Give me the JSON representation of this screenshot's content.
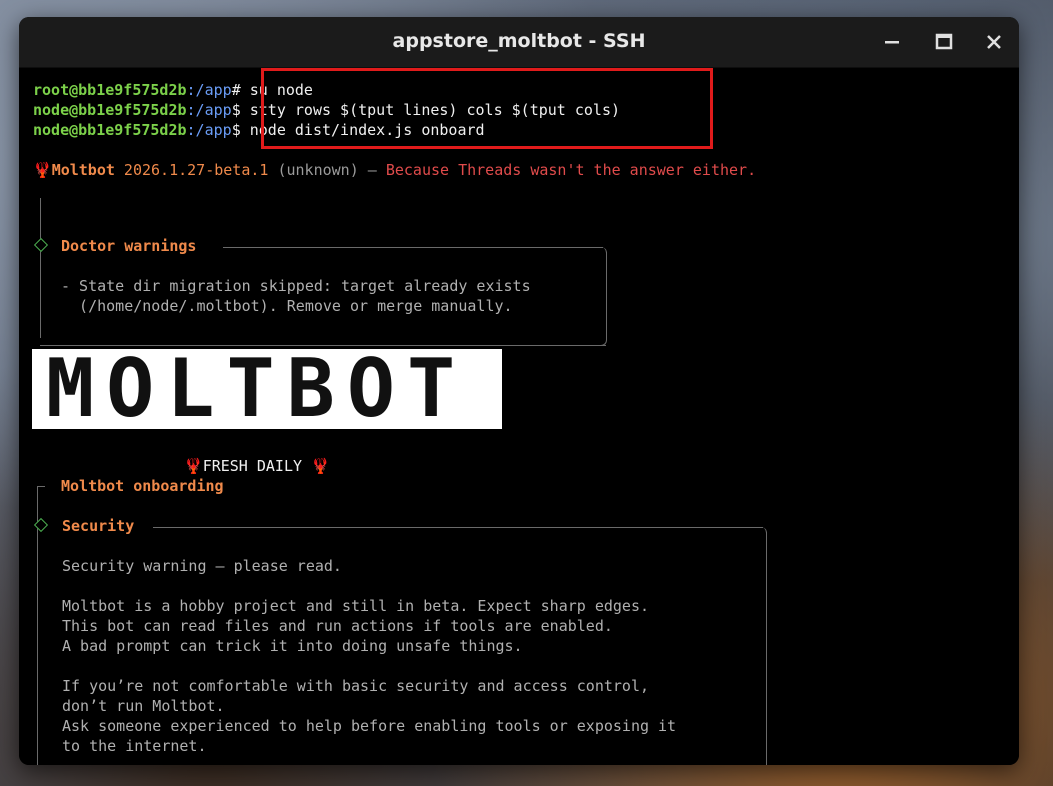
{
  "window": {
    "title": "appstore_moltbot - SSH",
    "controls": {
      "minimize": "—",
      "maximize": "☐",
      "close": "✕"
    }
  },
  "commands": [
    {
      "user": "root@bb1e9f575d2b",
      "path": ":/app",
      "symbol": "#",
      "cmd": " su node"
    },
    {
      "user": "node@bb1e9f575d2b",
      "path": ":/app",
      "symbol": "$",
      "cmd": " stty rows $(tput lines) cols $(tput cols)"
    },
    {
      "user": "node@bb1e9f575d2b",
      "path": ":/app",
      "symbol": "$",
      "cmd": " node dist/index.js onboard"
    }
  ],
  "banner": {
    "emoji": "🦞",
    "app": "Moltbot",
    "version": " 2026.1.27-beta.1",
    "unknown": " (unknown) — ",
    "tagline": "Because Threads wasn't the answer either."
  },
  "doctor": {
    "title": "Doctor warnings",
    "lines": [
      "- State dir migration skipped: target already exists",
      "  (/home/node/.moltbot). Remove or merge manually."
    ]
  },
  "logo": {
    "text": "MOLTBOT",
    "sub_emoji": "🦞",
    "sub": "FRESH DAILY"
  },
  "onboarding": {
    "title": "Moltbot onboarding"
  },
  "security": {
    "title": "Security",
    "lines": [
      "Security warning — please read.",
      "",
      "Moltbot is a hobby project and still in beta. Expect sharp edges.",
      "This bot can read files and run actions if tools are enabled.",
      "A bad prompt can trick it into doing unsafe things.",
      "",
      "If you’re not comfortable with basic security and access control,",
      "don’t run Moltbot.",
      "Ask someone experienced to help before enabling tools or exposing it",
      "to the internet."
    ]
  }
}
